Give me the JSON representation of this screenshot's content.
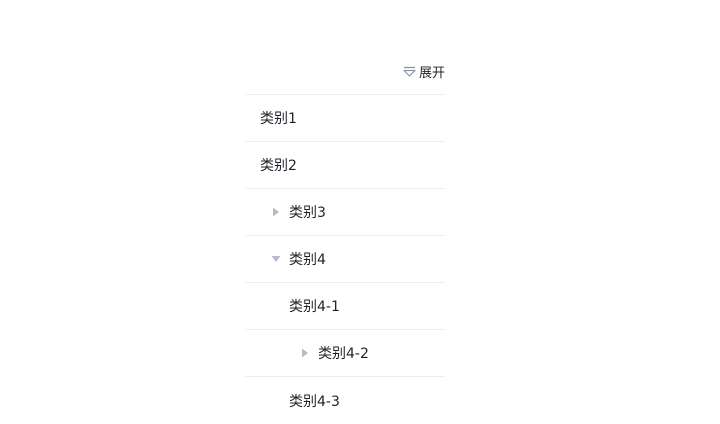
{
  "toolbar": {
    "expand_label": "展开"
  },
  "tree": {
    "items": [
      {
        "label": "类别1"
      },
      {
        "label": "类别2"
      },
      {
        "label": "类别3",
        "state": "collapsed"
      },
      {
        "label": "类别4",
        "state": "expanded"
      },
      {
        "label": "类别4-1"
      },
      {
        "label": "类别4-2",
        "state": "collapsed"
      },
      {
        "label": "类别4-3"
      }
    ]
  },
  "colors": {
    "caret": "#b4bccc",
    "divider": "#ebedf0",
    "text": "#1f2329"
  },
  "icons": {
    "expand": "expand-all-icon",
    "collapsed": "caret-right-icon",
    "expanded": "caret-down-icon"
  }
}
